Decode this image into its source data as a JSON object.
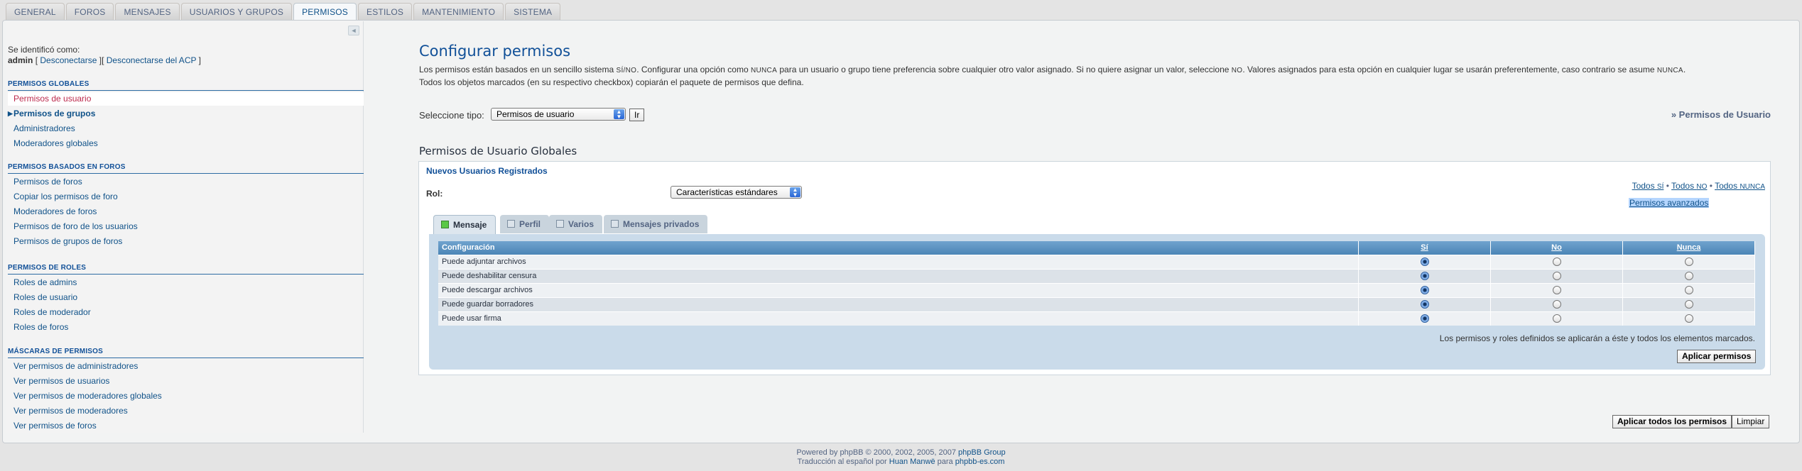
{
  "tabs": [
    "GENERAL",
    "FOROS",
    "MENSAJES",
    "USUARIOS Y GRUPOS",
    "PERMISOS",
    "ESTILOS",
    "MANTENIMIENTO",
    "SISTEMA"
  ],
  "active_tab": "PERMISOS",
  "sidebar": {
    "collapse_icon": "◄",
    "login_label": "Se identificó como:",
    "username": "admin",
    "logout": "Desconectarse",
    "logout_acp": "Desconectarse del ACP",
    "sections": [
      {
        "title": "PERMISOS GLOBALES",
        "items": [
          "Permisos de usuario",
          "Permisos de grupos",
          "Administradores",
          "Moderadores globales"
        ]
      },
      {
        "title": "PERMISOS BASADOS EN FOROS",
        "items": [
          "Permisos de foros",
          "Copiar los permisos de foro",
          "Moderadores de foros",
          "Permisos de foro de los usuarios",
          "Permisos de grupos de foros"
        ]
      },
      {
        "title": "PERMISOS DE ROLES",
        "items": [
          "Roles de admins",
          "Roles de usuario",
          "Roles de moderador",
          "Roles de foros"
        ]
      },
      {
        "title": "MÁSCARAS DE PERMISOS",
        "items": [
          "Ver permisos de administradores",
          "Ver permisos de usuarios",
          "Ver permisos de moderadores globales",
          "Ver permisos de moderadores",
          "Ver permisos de foros"
        ]
      }
    ]
  },
  "main": {
    "title": "Configurar permisos",
    "intro_1": "Los permisos están basados en un sencillo sistema ",
    "intro_si_no": "SÍ/NO",
    "intro_2": ". Configurar una opción como ",
    "intro_nunca": "NUNCA",
    "intro_3": " para un usuario o grupo tiene preferencia sobre cualquier otro valor asignado. Si no quiere asignar un valor, seleccione ",
    "intro_no": "NO",
    "intro_4": ". Valores asignados para esta opción en cualquier lugar se usarán preferentemente, caso contrario se asume ",
    "intro_nunca2": "NUNCA",
    "intro_5": ".",
    "intro_line2": "Todos los objetos marcados (en su respectivo checkbox) copiarán el paquete de permisos que defina.",
    "type_label": "Seleccione tipo:",
    "type_value": "Permisos de usuario",
    "go_button": "Ir",
    "crumb": "» Permisos de Usuario",
    "section_title": "Permisos de Usuario Globales",
    "group_name": "Nuevos Usuarios Registrados",
    "role_label": "Rol:",
    "role_value": "Características estándares",
    "all_yes": "Todos ",
    "all_yes_sc": "SÍ",
    "all_no": "Todos ",
    "all_no_sc": "NO",
    "all_never": "Todos ",
    "all_never_sc": "NUNCA",
    "advanced": "Permisos avanzados",
    "perm_tabs": [
      "Mensaje",
      "Perfil",
      "Varios",
      "Mensajes privados"
    ],
    "table": {
      "headers": [
        "Configuración",
        "Sí",
        "No",
        "Nunca"
      ],
      "rows": [
        {
          "label": "Puede adjuntar archivos",
          "value": "yes"
        },
        {
          "label": "Puede deshabilitar censura",
          "value": "yes"
        },
        {
          "label": "Puede descargar archivos",
          "value": "yes"
        },
        {
          "label": "Puede guardar borradores",
          "value": "yes"
        },
        {
          "label": "Puede usar firma",
          "value": "yes"
        }
      ]
    },
    "note": "Los permisos y roles definidos se aplicarán a éste y todos los elementos marcados.",
    "apply_button": "Aplicar permisos",
    "apply_all_button": "Aplicar todos los permisos",
    "reset_button": "Limpiar"
  },
  "footer": {
    "line1_pre": "Powered by phpBB © 2000, 2002, 2005, 2007 ",
    "line1_link": "phpBB Group",
    "line2_pre": "Traducción al español por ",
    "line2_link1": "Huan Manwë",
    "line2_mid": " para ",
    "line2_link2": "phpbb-es.com"
  }
}
